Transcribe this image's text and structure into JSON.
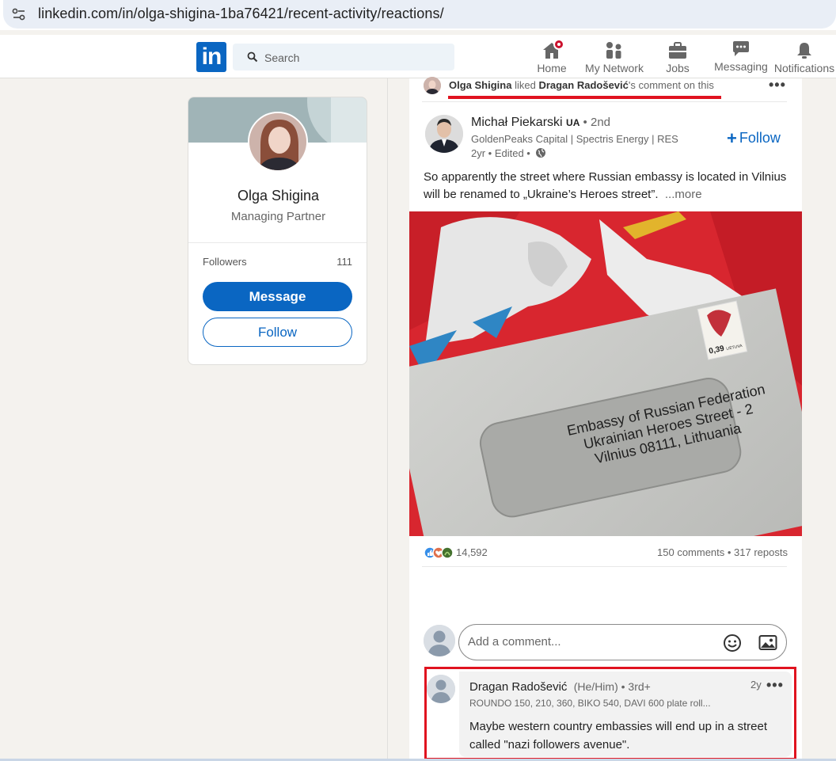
{
  "browser": {
    "url": "linkedin.com/in/olga-shigina-1ba76421/recent-activity/reactions/"
  },
  "nav": {
    "logo": "in",
    "search_placeholder": "Search",
    "items": [
      {
        "label": "Home",
        "icon": "home-icon",
        "has_badge": true
      },
      {
        "label": "My Network",
        "icon": "network-icon"
      },
      {
        "label": "Jobs",
        "icon": "briefcase-icon"
      },
      {
        "label": "Messaging",
        "icon": "messaging-icon"
      },
      {
        "label": "Notifications",
        "icon": "bell-icon"
      }
    ]
  },
  "profile": {
    "name": "Olga Shigina",
    "title": "Managing Partner",
    "followers_label": "Followers",
    "followers_count": "111",
    "message_label": "Message",
    "follow_label": "Follow"
  },
  "activity": {
    "actor": "Olga Shigina",
    "verb": " liked ",
    "target": "Dragan Radošević",
    "suffix": "'s comment on this"
  },
  "post": {
    "author": "Michał Piekarski",
    "author_flag": "UA",
    "degree": " • 2nd",
    "headline": "GoldenPeaks Capital | Spectris Energy | RES",
    "time": "2yr • Edited •",
    "follow_label": "Follow",
    "text": "So apparently the street where Russian embassy is located in Vilnius will be renamed to „Ukraine’s Heroes street”.",
    "more_label": "...more",
    "image": {
      "envelope_lines": [
        "Embassy of Russian Federation",
        "Ukrainian Heroes Street - 2",
        "Vilnius 08111, Lithuania"
      ],
      "stamp_value": "0,39",
      "stamp_country": "LIETUVA"
    },
    "reactions_count": "14,592",
    "comments_reposts": "150 comments • 317 reposts",
    "comment_placeholder": "Add a comment..."
  },
  "comment": {
    "author": "Dragan Radošević",
    "pronouns": "(He/Him)",
    "degree": " • 3rd+",
    "time": "2y",
    "headline": "ROUNDO 150, 210, 360, BIKO 540, DAVI 600 plate roll...",
    "text": "Maybe western country embassies will end up in a street called \"nazi followers avenue\"."
  },
  "colors": {
    "brand": "#0a66c2",
    "highlight": "#e0131f",
    "flag_red": "#d7262e"
  }
}
